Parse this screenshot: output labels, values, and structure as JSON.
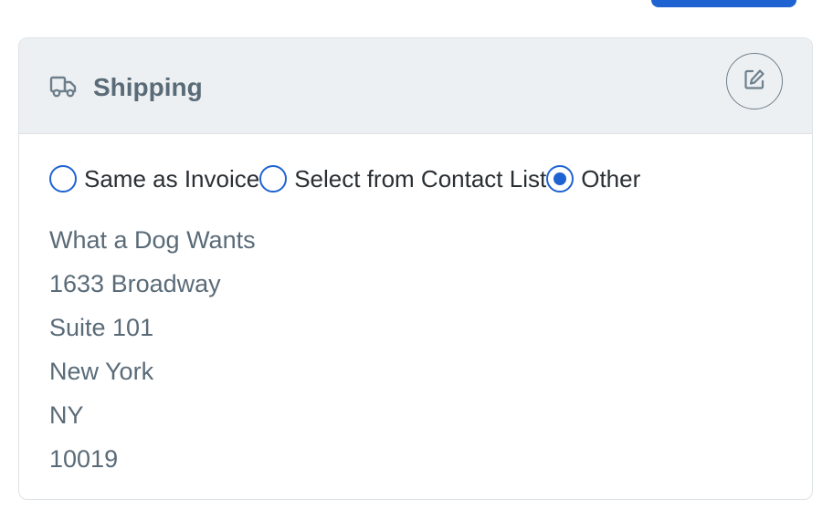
{
  "card": {
    "title": "Shipping",
    "icons": {
      "header_icon": "truck-icon",
      "edit_icon": "edit-icon"
    }
  },
  "shipping_options": [
    {
      "label": "Same as Invoice",
      "selected": false
    },
    {
      "label": "Select from Contact List",
      "selected": false
    },
    {
      "label": "Other",
      "selected": true
    }
  ],
  "address": {
    "name": "What a Dog Wants",
    "street": "1633 Broadway",
    "suite": "Suite 101",
    "city": "New York",
    "state": "NY",
    "zip": "10019"
  },
  "colors": {
    "accent": "#1f63d3",
    "header_bg": "#edf0f2",
    "muted_text": "#5a6b78"
  }
}
